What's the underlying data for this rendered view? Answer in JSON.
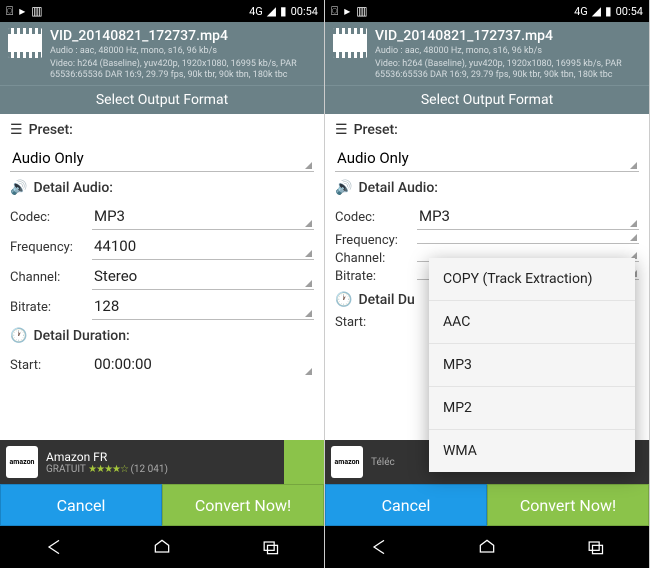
{
  "status": {
    "time": "00:54",
    "net": "4G"
  },
  "header": {
    "filename": "VID_20140821_172737.mp4",
    "audio_line": "Audio : aac, 48000 Hz, mono, s16, 96 kb/s",
    "video_line": "Video: h264 (Baseline), yuv420p, 1920x1080, 16995 kb/s, PAR 65536:65536 DAR 16:9, 29.79 fps, 90k tbr, 90k tbn, 180k tbc",
    "select_output": "Select Output Format"
  },
  "labels": {
    "preset": "Preset:",
    "detail_audio": "Detail Audio:",
    "codec": "Codec:",
    "frequency": "Frequency:",
    "channel": "Channel:",
    "bitrate": "Bitrate:",
    "detail_duration": "Detail Duration:",
    "start": "Start:",
    "detail_du_short": "Detail Du"
  },
  "values": {
    "preset": "Audio Only",
    "codec": "MP3",
    "frequency": "44100",
    "channel": "Stereo",
    "bitrate": "128",
    "start": "00:00:00"
  },
  "ad": {
    "brand": "amazon",
    "title": "Amazon FR",
    "subtitle": "GRATUIT",
    "count": "(12 041)",
    "telecharger": "Téléc"
  },
  "buttons": {
    "cancel": "Cancel",
    "convert": "Convert Now!"
  },
  "popup": {
    "items": [
      "COPY (Track Extraction)",
      "AAC",
      "MP3",
      "MP2",
      "WMA"
    ]
  }
}
